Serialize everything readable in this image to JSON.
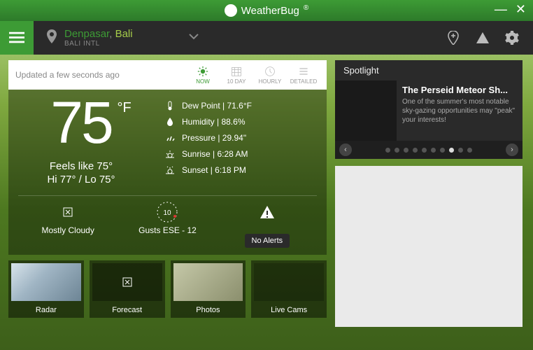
{
  "brand": "WeatherBug",
  "location": {
    "city": "Denpasar",
    "country": "Bali",
    "sub": "BALI INTL"
  },
  "updated": "Updated a few seconds ago",
  "tabs": {
    "now": "NOW",
    "tenday": "10 DAY",
    "hourly": "HOURLY",
    "detailed": "DETAILED"
  },
  "current": {
    "temp": "75",
    "unit": "°F",
    "feels": "Feels like 75°",
    "hilo": "Hi 77° / Lo 75°"
  },
  "details": {
    "dewpoint": "Dew Point  |  71.6°F",
    "humidity": "Humidity  |  88.6%",
    "pressure": "Pressure  |  29.94\"",
    "sunrise": "Sunrise  |  6:28 AM",
    "sunset": "Sunset  |  6:18 PM"
  },
  "mid": {
    "condition": "Mostly Cloudy",
    "wind_value": "10",
    "wind_label": "Gusts ESE - 12",
    "alerts": "No Alerts"
  },
  "cards": {
    "radar": "Radar",
    "forecast": "Forecast",
    "photos": "Photos",
    "livecams": "Live Cams"
  },
  "spotlight": {
    "header": "Spotlight",
    "title": "The Perseid Meteor Sh...",
    "desc": "One of the summer's most notable sky-gazing opportunities may \"peak\" your interests!"
  }
}
